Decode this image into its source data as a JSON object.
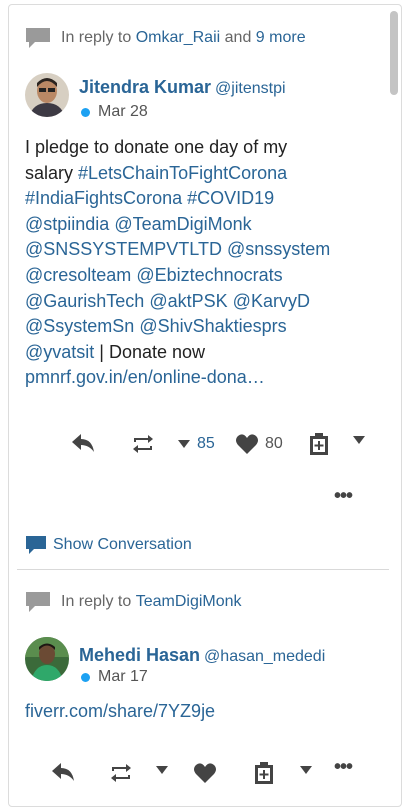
{
  "tweets": [
    {
      "reply_prefix": "In reply to",
      "reply_user": "Omkar_Raii",
      "reply_and": "and",
      "reply_more": "9 more",
      "author_name": "Jitendra Kumar",
      "author_handle": "@jitenstpi",
      "date": "Mar 28",
      "text_lines": [
        [
          {
            "t": "I pledge to donate one day of my",
            "link": false
          }
        ],
        [
          {
            "t": "salary ",
            "link": false
          },
          {
            "t": "#LetsChainToFightCorona",
            "link": true
          }
        ],
        [
          {
            "t": "#IndiaFightsCorona",
            "link": true
          },
          {
            "t": " ",
            "link": false
          },
          {
            "t": "#COVID19",
            "link": true
          }
        ],
        [
          {
            "t": "@stpiindia",
            "link": true
          },
          {
            "t": " ",
            "link": false
          },
          {
            "t": "@TeamDigiMonk",
            "link": true
          }
        ],
        [
          {
            "t": "@SNSSYSTEMPVTLTD",
            "link": true
          },
          {
            "t": " ",
            "link": false
          },
          {
            "t": "@snssystem",
            "link": true
          }
        ],
        [
          {
            "t": "@cresolteam",
            "link": true
          },
          {
            "t": " ",
            "link": false
          },
          {
            "t": "@Ebiztechnocrats",
            "link": true
          }
        ],
        [
          {
            "t": "@GaurishTech",
            "link": true
          },
          {
            "t": " ",
            "link": false
          },
          {
            "t": "@aktPSK",
            "link": true
          },
          {
            "t": " ",
            "link": false
          },
          {
            "t": "@KarvyD",
            "link": true
          }
        ],
        [
          {
            "t": "@SsystemSn",
            "link": true
          },
          {
            "t": " ",
            "link": false
          },
          {
            "t": "@ShivShaktiesprs",
            "link": true
          }
        ],
        [
          {
            "t": "@yvatsit",
            "link": true
          },
          {
            "t": " | Donate now",
            "link": false
          }
        ],
        [
          {
            "t": "pmnrf.gov.in/en/online-dona…",
            "link": true
          }
        ]
      ],
      "retweets": "85",
      "likes": "80"
    },
    {
      "reply_prefix": "In reply to",
      "reply_user": "TeamDigiMonk",
      "author_name": "Mehedi Hasan",
      "author_handle": "@hasan_mededi",
      "date": "Mar 17",
      "text_lines": [
        [
          {
            "t": "fiverr.com/share/7YZ9je",
            "link": true
          }
        ]
      ]
    }
  ],
  "show_conversation": "Show Conversation",
  "more_glyph": "•••",
  "colors": {
    "link": "#2a6596",
    "dot": "#1da1f2",
    "icon": "#444444"
  },
  "icons": [
    "reply-bubble-icon",
    "reply-arrow-icon",
    "retweet-icon",
    "caret-down-icon",
    "heart-icon",
    "bookmark-plus-icon",
    "more-dots-icon",
    "conversation-bubble-icon"
  ]
}
